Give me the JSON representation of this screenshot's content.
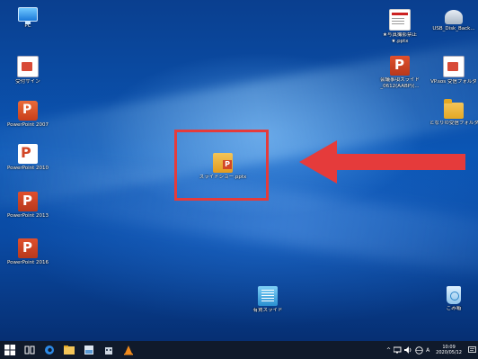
{
  "desktop": {
    "icons": [
      {
        "name": "pc-icon",
        "label": "PC"
      },
      {
        "name": "reception-sign-icon",
        "label": "受付サイン"
      },
      {
        "name": "powerpoint-2007-icon",
        "label": "PowerPoint 2007"
      },
      {
        "name": "powerpoint-2010-icon",
        "label": "PowerPoint 2010"
      },
      {
        "name": "powerpoint-2013-icon",
        "label": "PowerPoint 2013"
      },
      {
        "name": "powerpoint-2016-icon",
        "label": "PowerPoint 2016"
      },
      {
        "name": "no-photography-file-icon",
        "label": "★写真撮影禁止\n★.pptx"
      },
      {
        "name": "usb-disk-icon",
        "label": "USB_Disk_Back..."
      },
      {
        "name": "meeting-slide-file-icon",
        "label": "会議事項スライド\n_0612(AABP)(..."
      },
      {
        "name": "vp-folder-icon",
        "label": "VP.sos 受信フォルダ"
      },
      {
        "name": "neighbor-folder-icon",
        "label": "となりの受信フォルダ"
      },
      {
        "name": "slideshow-file-icon",
        "label": "スライドショー.pptx"
      },
      {
        "name": "rules-slide-icon",
        "label": "有賀スライド"
      },
      {
        "name": "recycle-bin-icon",
        "label": "ごみ箱"
      }
    ]
  },
  "taskbar": {
    "tray_chevron": "^",
    "ime": "A",
    "clock_time": "10:09",
    "clock_date": "2020/05/12"
  },
  "colors": {
    "highlight": "#e53b3b",
    "taskbar": "#101a2b"
  }
}
